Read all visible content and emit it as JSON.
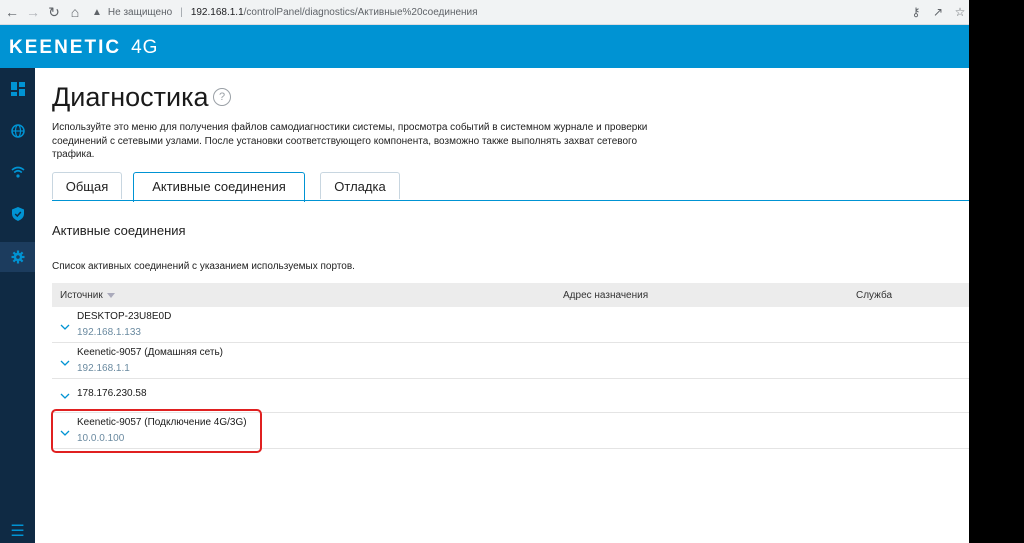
{
  "browser": {
    "security_label": "Не защищено",
    "url_host": "192.168.1.1",
    "url_path": "/controlPanel/diagnostics/Активные%20соединения"
  },
  "header": {
    "brand": "KEENETIC",
    "model": "4G",
    "color": "#0093d3"
  },
  "sidebar": {
    "items": [
      {
        "icon": "dashboard-icon"
      },
      {
        "icon": "globe-icon"
      },
      {
        "icon": "wifi-icon"
      },
      {
        "icon": "shield-icon"
      },
      {
        "icon": "gear-icon",
        "active": true
      }
    ],
    "menu_icon": "hamburger-icon"
  },
  "page": {
    "title": "Диагностика",
    "help": "?",
    "description": "Используйте это меню для получения файлов самодиагностики системы, просмотра событий в системном журнале и проверки соединений с сетевыми узлами. После установки соответствующего компонента, возможно также выполнять захват сетевого трафика."
  },
  "tabs": [
    {
      "label": "Общая"
    },
    {
      "label": "Активные соединения",
      "active": true
    },
    {
      "label": "Отладка"
    }
  ],
  "section": {
    "title": "Активные соединения",
    "description": "Список активных соединений с указанием используемых портов."
  },
  "table": {
    "columns": [
      "Источник",
      "Адрес назначения",
      "Служба"
    ],
    "rows": [
      {
        "name": "DESKTOP-23U8E0D",
        "ip": "192.168.1.133"
      },
      {
        "name": "Keenetic-9057 (Домашняя сеть)",
        "ip": "192.168.1.1"
      },
      {
        "name": "178.176.230.58",
        "ip": ""
      },
      {
        "name": "Keenetic-9057 (Подключение 4G/3G)",
        "ip": "10.0.0.100",
        "highlighted": true
      }
    ]
  }
}
